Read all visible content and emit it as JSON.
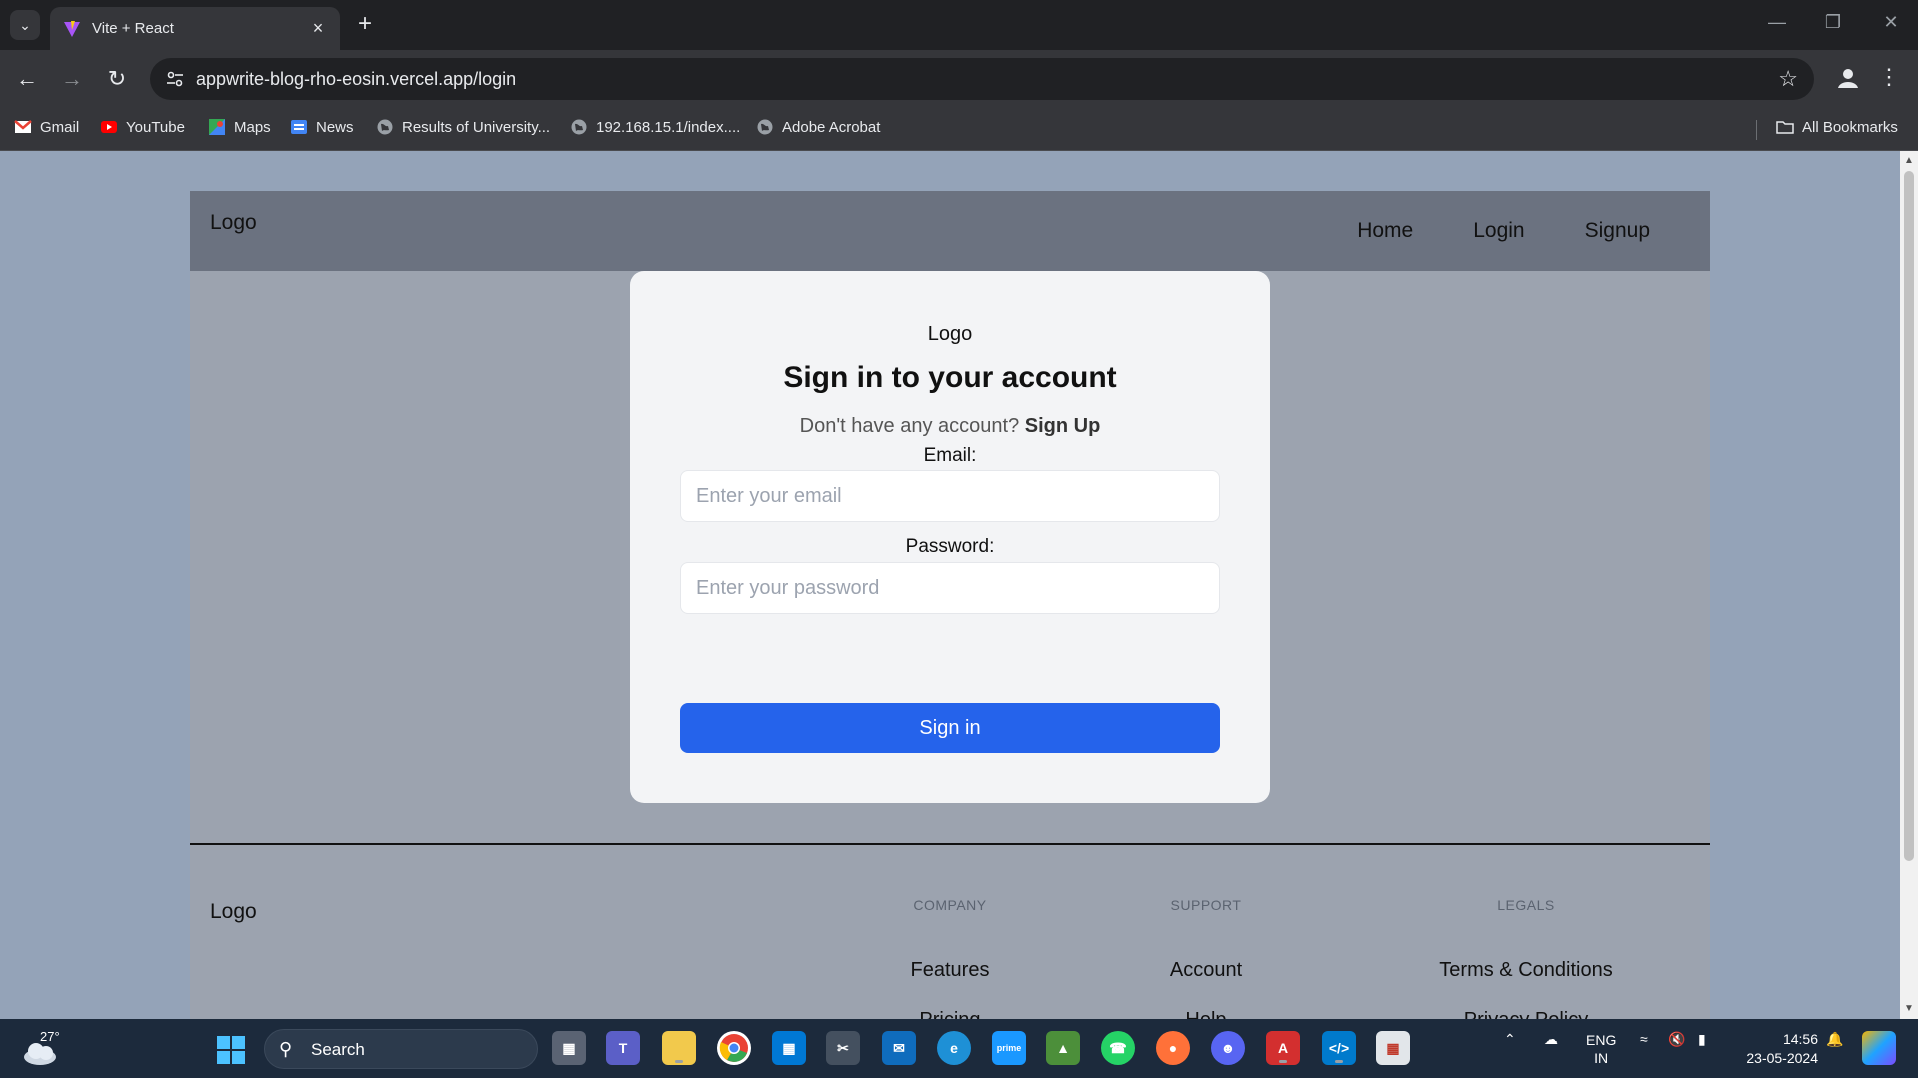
{
  "browser": {
    "tab_title": "Vite + React",
    "url": "appwrite-blog-rho-eosin.vercel.app/login",
    "bookmarks": [
      {
        "label": "Gmail",
        "icon": "gmail-icon"
      },
      {
        "label": "YouTube",
        "icon": "youtube-icon"
      },
      {
        "label": "Maps",
        "icon": "maps-icon"
      },
      {
        "label": "News",
        "icon": "news-icon"
      },
      {
        "label": "Results of University...",
        "icon": "globe-icon"
      },
      {
        "label": "192.168.15.1/index....",
        "icon": "globe-icon"
      },
      {
        "label": "Adobe Acrobat",
        "icon": "globe-icon"
      }
    ],
    "all_bookmarks": "All Bookmarks"
  },
  "header": {
    "logo": "Logo",
    "nav": [
      {
        "label": "Home"
      },
      {
        "label": "Login"
      },
      {
        "label": "Signup"
      }
    ]
  },
  "login": {
    "logo": "Logo",
    "title": "Sign in to your account",
    "prompt": "Don't have any account?",
    "signup_link": "Sign Up",
    "email_label": "Email:",
    "email_placeholder": "Enter your email",
    "email_value": "",
    "password_label": "Password:",
    "password_placeholder": "Enter your password",
    "password_value": "",
    "submit": "Sign in"
  },
  "footer": {
    "logo": "Logo",
    "company": {
      "heading": "COMPANY",
      "links": [
        "Features",
        "Pricing"
      ]
    },
    "support": {
      "heading": "SUPPORT",
      "links": [
        "Account",
        "Help"
      ]
    },
    "legals": {
      "heading": "LEGALS",
      "links": [
        "Terms & Conditions",
        "Privacy Policy"
      ]
    }
  },
  "taskbar": {
    "temperature": "27°",
    "search": "Search",
    "lang_line1": "ENG",
    "lang_line2": "IN",
    "time": "14:56",
    "date": "23-05-2024"
  },
  "colors": {
    "page_bg": "#94a3b8",
    "header_bg": "#6b7280",
    "card_bg": "#f3f4f6",
    "primary_button": "#2563eb"
  }
}
